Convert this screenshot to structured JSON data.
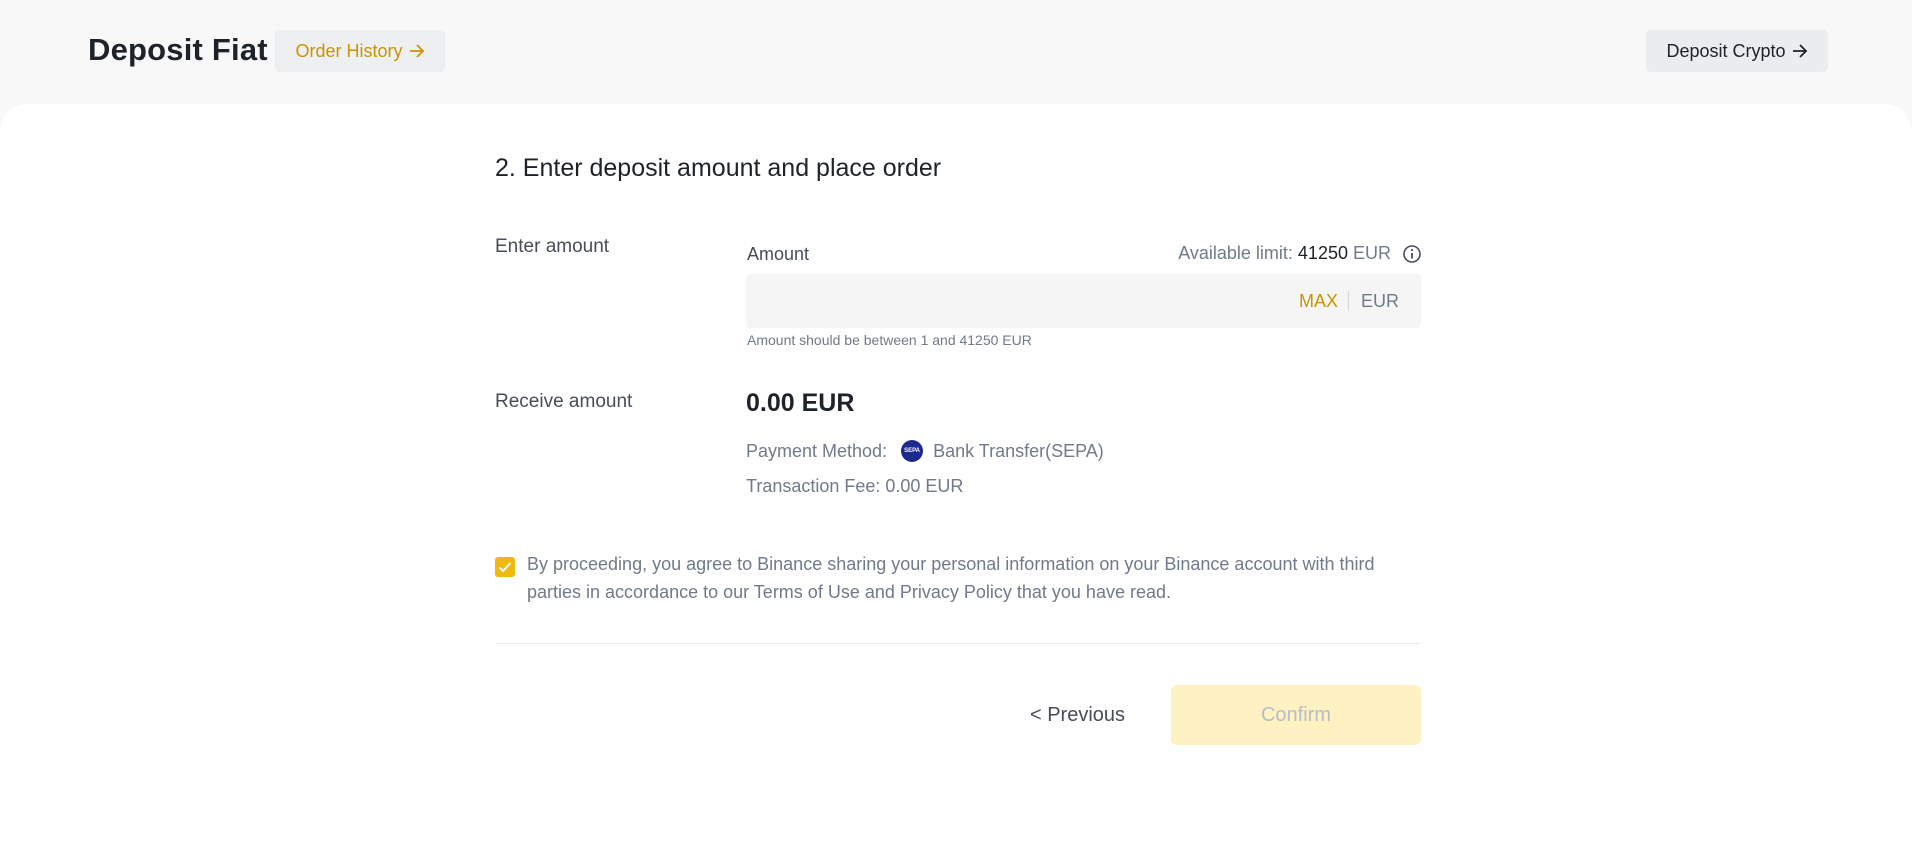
{
  "header": {
    "title": "Deposit Fiat",
    "order_history_label": "Order History",
    "deposit_crypto_label": "Deposit Crypto"
  },
  "form": {
    "step_title": "2. Enter deposit amount and place order",
    "enter_amount_label": "Enter amount",
    "amount_field_label": "Amount",
    "available_limit_label": "Available limit:",
    "available_limit_value": "41250",
    "available_limit_unit": "EUR",
    "amount_value": "",
    "amount_placeholder": "",
    "max_label": "MAX",
    "currency_unit": "EUR",
    "hint": "Amount should be between 1 and 41250 EUR",
    "receive_amount_label": "Receive amount",
    "receive_amount_value": "0.00 EUR",
    "payment_method_label": "Payment Method:",
    "payment_method_icon_text": "SEPA",
    "payment_method_value": "Bank Transfer(SEPA)",
    "transaction_fee": "Transaction Fee: 0.00 EUR",
    "agreement_checked": true,
    "agreement_text": "By proceeding, you agree to Binance sharing your personal information on your Binance account with third parties in accordance to our Terms of Use and Privacy Policy that you have read."
  },
  "actions": {
    "previous_label": "< Previous",
    "confirm_label": "Confirm"
  },
  "colors": {
    "accent": "#f0b90b",
    "accent_text": "#c99400",
    "confirm_disabled_bg": "#fef1c2"
  }
}
